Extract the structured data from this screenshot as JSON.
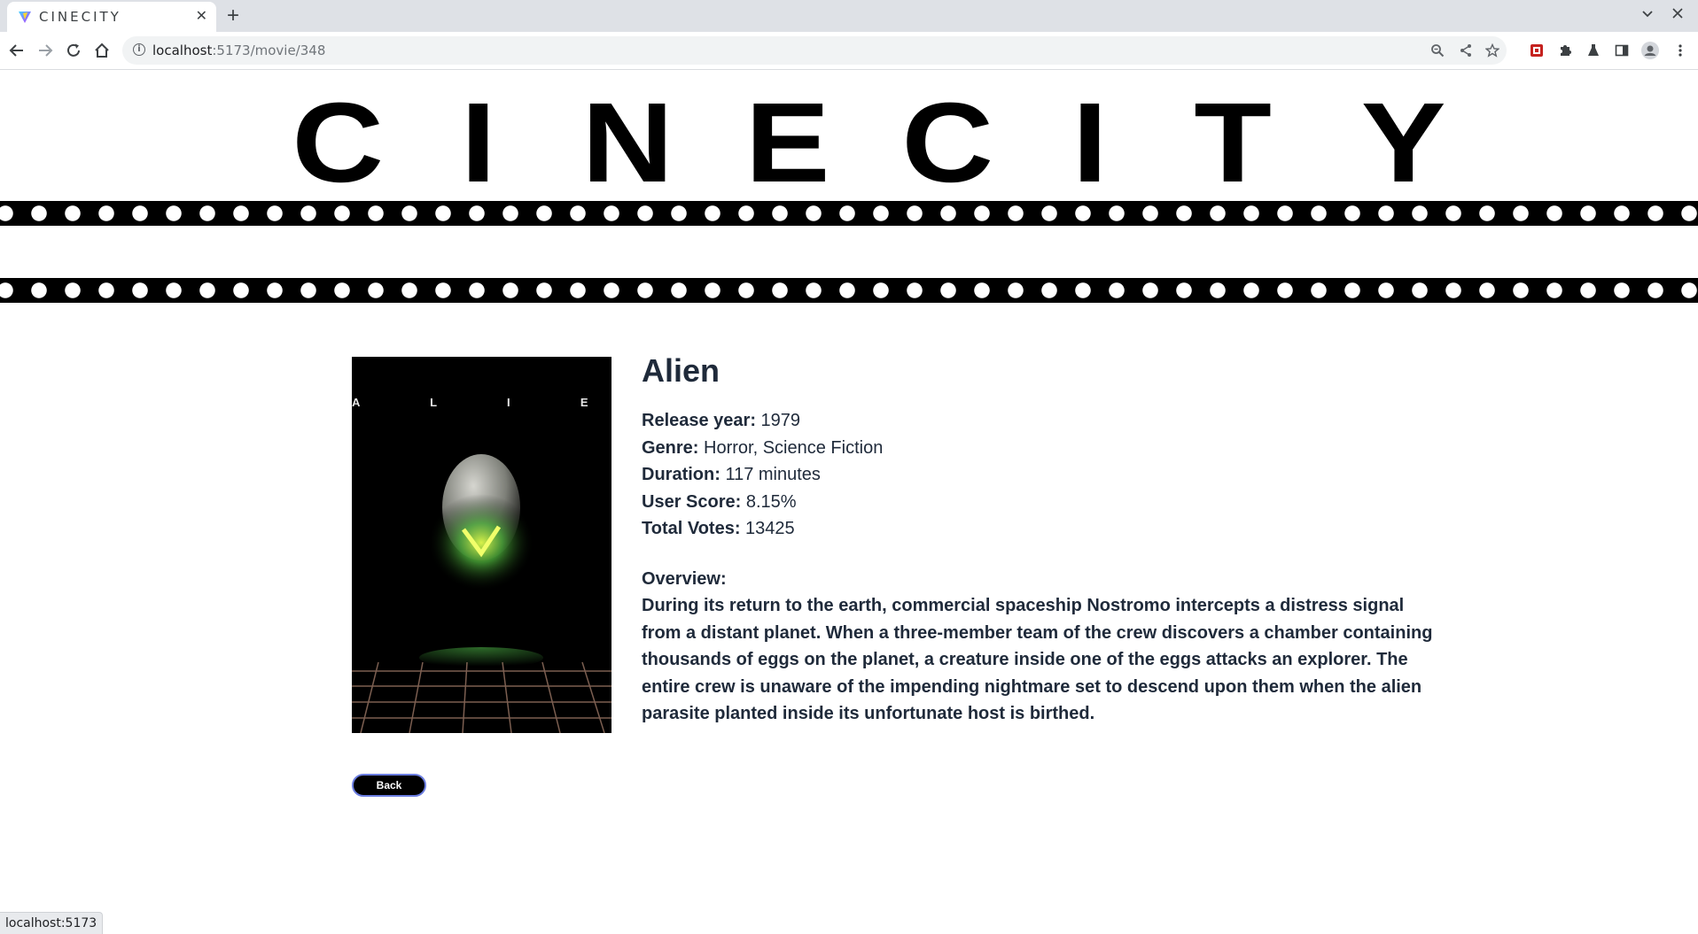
{
  "browser": {
    "tab_title": "CINECITY",
    "tab_close": "✕",
    "new_tab": "+",
    "url_host": "localhost",
    "url_path": ":5173/movie/348",
    "status_text": "localhost:5173"
  },
  "site": {
    "brand_letters": [
      "C",
      "I",
      "N",
      "E",
      "C",
      "I",
      "T",
      "Y"
    ]
  },
  "movie": {
    "title": "Alien",
    "poster_letters": "A  L  I  E  N",
    "release_label": "Release year:",
    "release_value": "1979",
    "genre_label": "Genre:",
    "genre_value": "Horror, Science Fiction",
    "duration_label": "Duration:",
    "duration_value": "117 minutes",
    "score_label": "User Score:",
    "score_value": "8.15%",
    "votes_label": "Total Votes:",
    "votes_value": "13425",
    "overview_label": "Overview:",
    "overview_text": "During its return to the earth, commercial spaceship Nostromo intercepts a distress signal from a distant planet. When a three-member team of the crew discovers a chamber containing thousands of eggs on the planet, a creature inside one of the eggs attacks an explorer. The entire crew is unaware of the impending nightmare set to descend upon them when the alien parasite planted inside its unfortunate host is birthed."
  },
  "actions": {
    "back_label": "Back"
  },
  "icons": {
    "back": "arrow-left-icon",
    "forward": "arrow-right-icon",
    "reload": "reload-icon",
    "home": "home-icon",
    "zoom": "zoom-icon",
    "share": "share-icon",
    "bookmark": "star-icon",
    "extensions": "puzzle-icon",
    "profile": "profile-icon",
    "menu": "kebab-menu-icon"
  }
}
